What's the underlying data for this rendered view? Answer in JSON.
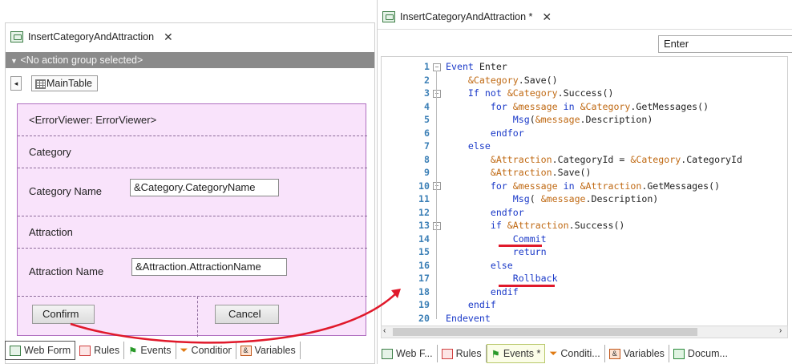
{
  "left": {
    "tab_title": "InsertCategoryAndAttraction",
    "action_group": "<No action group selected>",
    "table_name": "MainTable",
    "error_viewer": "<ErrorViewer: ErrorViewer>",
    "category_label": "Category",
    "category_name_label": "Category Name",
    "category_name_value": "&Category.CategoryName",
    "attraction_label": "Attraction",
    "attraction_name_label": "Attraction Name",
    "attraction_name_value": "&Attraction.AttractionName",
    "confirm_button": "Confirm",
    "cancel_button": "Cancel",
    "bottom_tabs": [
      "Web Form",
      "Rules",
      "Events",
      "Conditions",
      "Variables"
    ]
  },
  "right": {
    "tab_title": "InsertCategoryAndAttraction *",
    "event_dropdown": "Enter",
    "lines": [
      "Event Enter",
      "    &Category.Save()",
      "    If not &Category.Success()",
      "        for &message in &Category.GetMessages()",
      "            Msg(&message.Description)",
      "        endfor",
      "    else",
      "        &Attraction.CategoryId = &Category.CategoryId",
      "        &Attraction.Save()",
      "        for &message in &Attraction.GetMessages()",
      "            Msg( &message.Description)",
      "        endfor",
      "        if &Attraction.Success()",
      "            Commit",
      "            return",
      "        else",
      "            Rollback",
      "        endif",
      "    endif",
      "Endevent"
    ],
    "line_numbers": [
      "1",
      "2",
      "3",
      "4",
      "5",
      "6",
      "7",
      "8",
      "9",
      "10",
      "11",
      "12",
      "13",
      "14",
      "15",
      "16",
      "17",
      "18",
      "19",
      "20"
    ],
    "bottom_tabs": [
      "Web F...",
      "Rules",
      "Events *",
      "Conditi...",
      "Variables",
      "Docum..."
    ]
  },
  "colors": {
    "keyword": "#1a39c8",
    "variable": "#c06a14",
    "line_number": "#3b7fb6",
    "form_bg": "#f9e3fb",
    "annotation_red": "#e0192b"
  }
}
